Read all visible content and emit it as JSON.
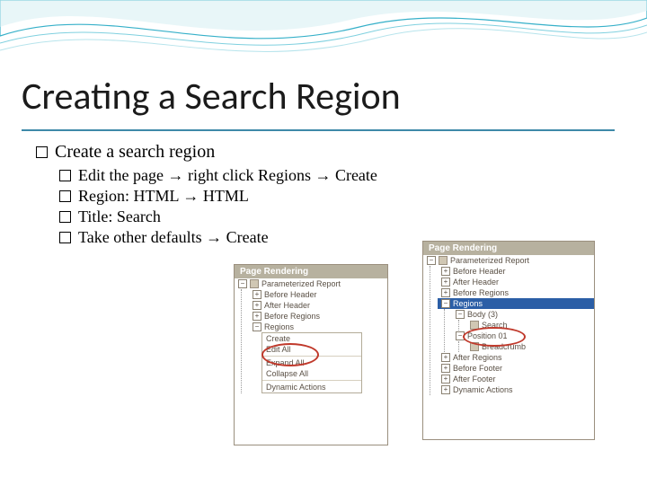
{
  "title": "Creating a Search Region",
  "bullet1": "Create a search region",
  "sub": [
    "Edit the page → right click Regions → Create",
    "Region: HTML → HTML",
    "Title: Search",
    "Take other defaults → Create"
  ],
  "panelLeft": {
    "header": "Page Rendering",
    "root": "Parameterized Report",
    "rows": [
      "Before Header",
      "After Header",
      "Before Regions",
      "Regions"
    ],
    "menu": [
      "Create",
      "Edit All",
      "Expand All",
      "Collapse All",
      "Dynamic Actions"
    ]
  },
  "panelRight": {
    "header": "Page Rendering",
    "root": "Parameterized Report",
    "rows": [
      "Before Header",
      "After Header",
      "Before Regions",
      "Regions"
    ],
    "bodyLabel": "Body (3)",
    "searchLabel": "Search",
    "posLabel": "Position 01",
    "breadcrumbLabel": "Breadcrumb",
    "after": [
      "After Regions",
      "Before Footer",
      "After Footer",
      "Dynamic Actions"
    ]
  }
}
